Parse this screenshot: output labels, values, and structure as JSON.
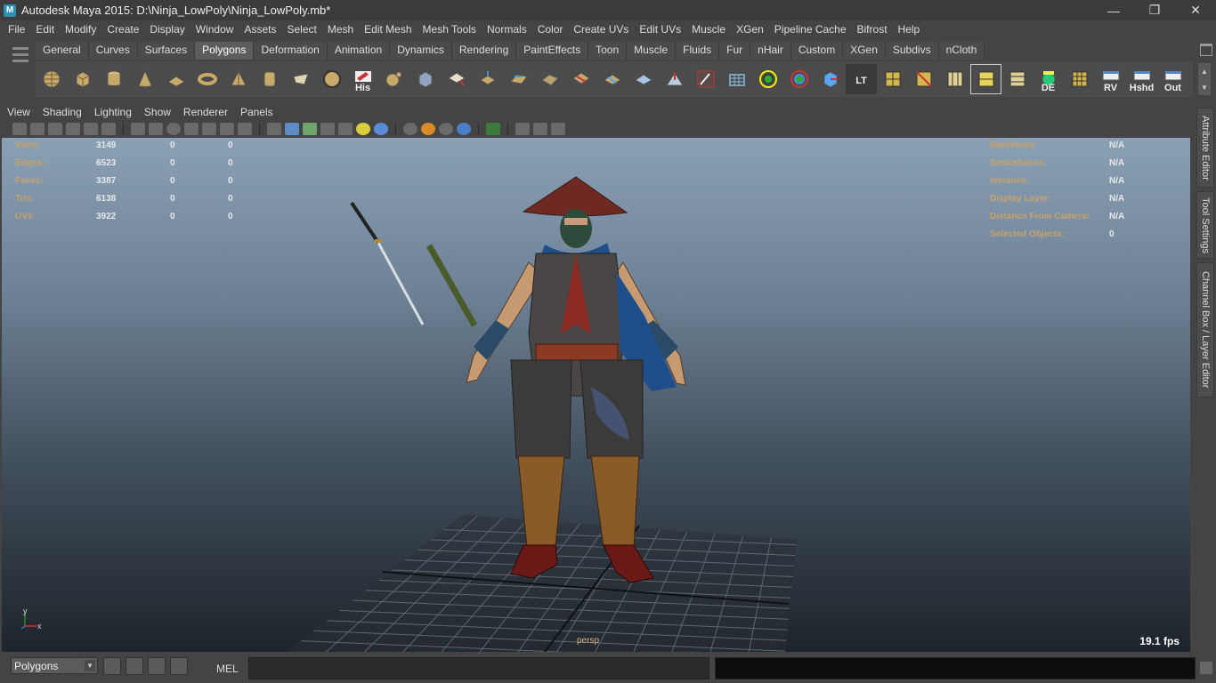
{
  "window": {
    "title": "Autodesk Maya 2015: D:\\Ninja_LowPoly\\Ninja_LowPoly.mb*",
    "app_icon": "M",
    "controls": [
      "minimize-icon",
      "restore-icon",
      "close-icon"
    ]
  },
  "menubar": [
    "File",
    "Edit",
    "Modify",
    "Create",
    "Display",
    "Window",
    "Assets",
    "Select",
    "Mesh",
    "Edit Mesh",
    "Mesh Tools",
    "Normals",
    "Color",
    "Create UVs",
    "Edit UVs",
    "Muscle",
    "XGen",
    "Pipeline Cache",
    "Bifrost",
    "Help"
  ],
  "shelf": {
    "tabs": [
      "General",
      "Curves",
      "Surfaces",
      "Polygons",
      "Deformation",
      "Animation",
      "Dynamics",
      "Rendering",
      "PaintEffects",
      "Toon",
      "Muscle",
      "Fluids",
      "Fur",
      "nHair",
      "Custom",
      "XGen",
      "Subdivs",
      "nCloth"
    ],
    "active_tab": "Polygons",
    "icon_labels": {
      "his": "His",
      "lt": "LT",
      "de": "DE",
      "rv": "RV",
      "hshd": "Hshd",
      "out": "Out"
    }
  },
  "panel": {
    "menu": [
      "View",
      "Shading",
      "Lighting",
      "Show",
      "Renderer",
      "Panels"
    ]
  },
  "hud": {
    "left": [
      {
        "label": "Verts:",
        "v1": "3149",
        "v2": "0",
        "v3": "0"
      },
      {
        "label": "Edges:",
        "v1": "6523",
        "v2": "0",
        "v3": "0"
      },
      {
        "label": "Faces:",
        "v1": "3387",
        "v2": "0",
        "v3": "0"
      },
      {
        "label": "Tris:",
        "v1": "6138",
        "v2": "0",
        "v3": "0"
      },
      {
        "label": "UVs:",
        "v1": "3922",
        "v2": "0",
        "v3": "0"
      }
    ],
    "right": [
      {
        "label": "Backfaces:",
        "value": "N/A"
      },
      {
        "label": "Smoothness:",
        "value": "N/A"
      },
      {
        "label": "Instance:",
        "value": "N/A"
      },
      {
        "label": "Display Layer:",
        "value": "N/A"
      },
      {
        "label": "Distance From Camera:",
        "value": "N/A"
      },
      {
        "label": "Selected Objects:",
        "value": "0"
      }
    ],
    "camera": "persp",
    "fps": "19.1 fps",
    "axis_y": "y",
    "axis_x": "x"
  },
  "side_tabs": [
    "Attribute Editor",
    "Tool Settings",
    "Channel Box / Layer Editor"
  ],
  "command": {
    "mode": "Polygons",
    "mel_label": "MEL",
    "input_value": ""
  }
}
